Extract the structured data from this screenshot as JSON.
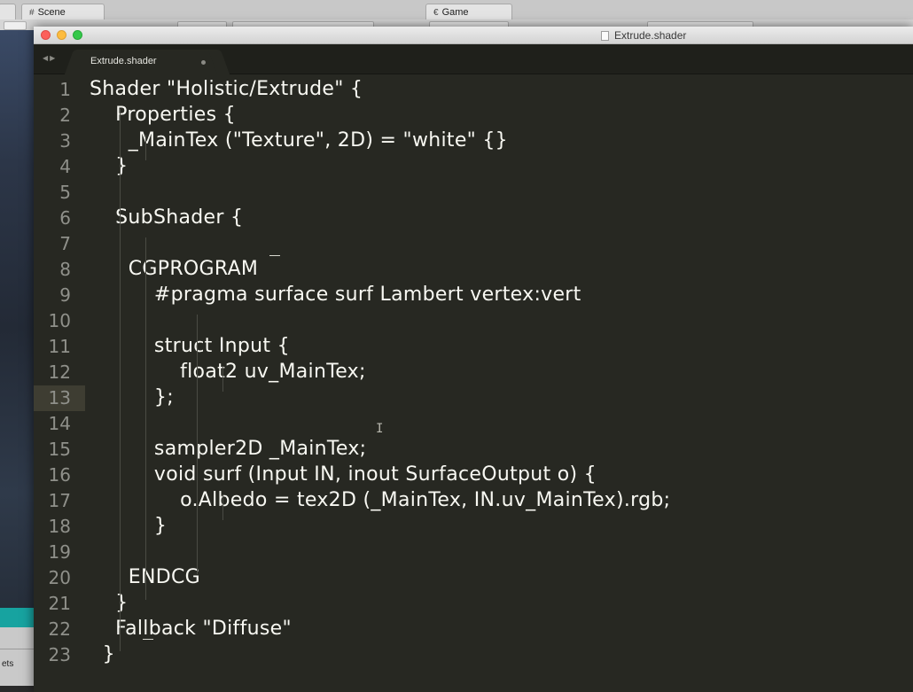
{
  "unity": {
    "scene_tab_label": "Scene",
    "game_tab_label": "Game",
    "assets_label": "ets"
  },
  "window": {
    "title": "Extrude.shader"
  },
  "tabs": [
    {
      "label": "Extrude.shader",
      "active": true
    }
  ],
  "editor": {
    "current_line": 13,
    "lines": [
      {
        "num": "1",
        "text": "Shader \"Holistic/Extrude\" {"
      },
      {
        "num": "2",
        "text": "    Properties {"
      },
      {
        "num": "3",
        "text": "      _MainTex (\"Texture\", 2D) = \"white\" {}"
      },
      {
        "num": "4",
        "text": "    }"
      },
      {
        "num": "5",
        "text": ""
      },
      {
        "num": "6",
        "text": "    SubShader {"
      },
      {
        "num": "7",
        "text": ""
      },
      {
        "num": "8",
        "text": "      CGPROGRAM"
      },
      {
        "num": "9",
        "text": "          #pragma surface surf Lambert vertex:vert"
      },
      {
        "num": "10",
        "text": ""
      },
      {
        "num": "11",
        "text": "          struct Input {"
      },
      {
        "num": "12",
        "text": "              float2 uv_MainTex;"
      },
      {
        "num": "13",
        "text": "          };"
      },
      {
        "num": "14",
        "text": ""
      },
      {
        "num": "15",
        "text": "          sampler2D _MainTex;"
      },
      {
        "num": "16",
        "text": "          void surf (Input IN, inout SurfaceOutput o) {"
      },
      {
        "num": "17",
        "text": "              o.Albedo = tex2D (_MainTex, IN.uv_MainTex).rgb;"
      },
      {
        "num": "18",
        "text": "          }"
      },
      {
        "num": "19",
        "text": ""
      },
      {
        "num": "20",
        "text": "      ENDCG"
      },
      {
        "num": "21",
        "text": "    }"
      },
      {
        "num": "22",
        "text": "    Fallback \"Diffuse\""
      },
      {
        "num": "23",
        "text": "  }"
      }
    ]
  },
  "colors": {
    "editor_bg": "#272822",
    "text": "#f8f8f2",
    "gutter_text": "#8f908a",
    "current_line": "#3e3d32"
  }
}
